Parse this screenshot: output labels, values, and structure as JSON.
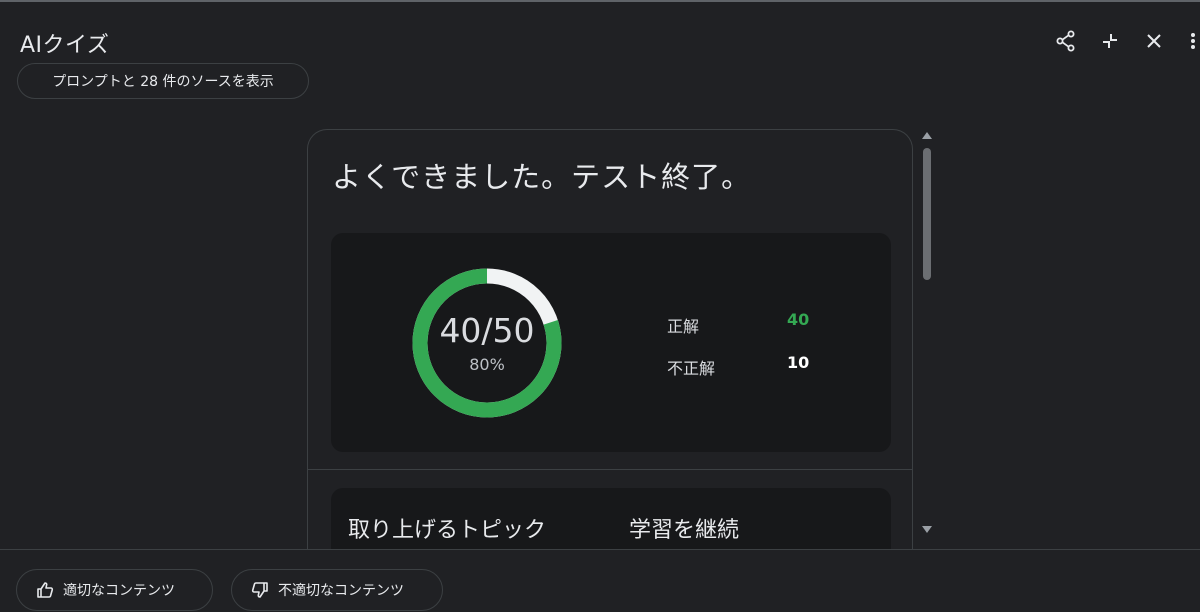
{
  "header": {
    "title": "AIクイズ",
    "source_button_label": "プロンプトと 28 件のソースを表示",
    "icons": [
      "share-icon",
      "collapse-icon",
      "close-icon",
      "more-vert-icon"
    ]
  },
  "result": {
    "heading": "よくできました。テスト終了。",
    "score_text": "40/50",
    "percent_text": "80%",
    "score_fraction": 0.8,
    "correct_label": "正解",
    "correct_value": "40",
    "incorrect_label": "不正解",
    "incorrect_value": "10"
  },
  "next": {
    "topics_label": "取り上げるトピック",
    "continue_label": "学習を継続"
  },
  "footer": {
    "good_label": "適切なコンテンツ",
    "bad_label": "不適切なコンテンツ"
  },
  "colors": {
    "background": "#202124",
    "correct": "#34a853",
    "ring_remainder": "#f1f3f4",
    "panel": "#17181a"
  }
}
